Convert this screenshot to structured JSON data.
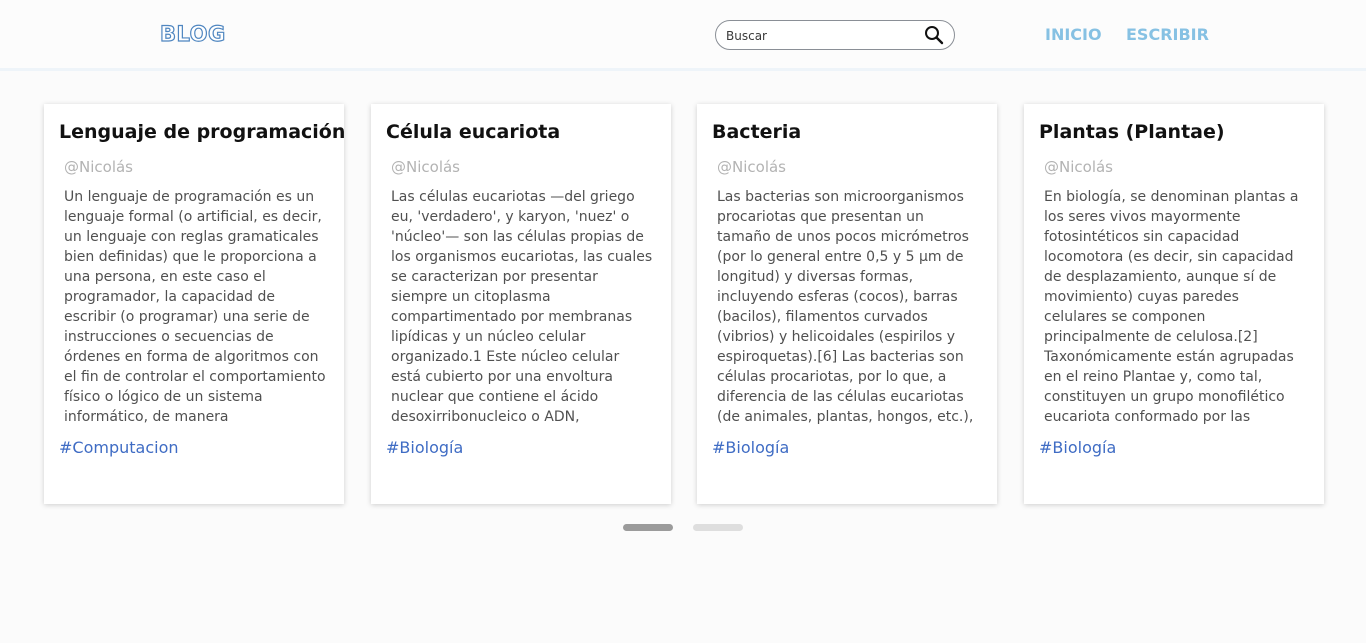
{
  "header": {
    "logo": "BLOG",
    "search": {
      "placeholder": "Buscar",
      "value": ""
    },
    "nav": [
      {
        "label": "INICIO"
      },
      {
        "label": "ESCRIBIR"
      }
    ]
  },
  "cards": [
    {
      "title": "Lenguaje de programación",
      "author": "@Nicolás",
      "body": "Un lenguaje de programación es un lenguaje formal (o artificial, es decir, un lenguaje con reglas gramaticales bien definidas) que le proporciona a una persona, en este caso el programador, la capacidad de escribir (o programar) una serie de instrucciones o secuencias de órdenes en forma de algoritmos con el fin de controlar el comportamiento físico o lógico de un sistema informático, de manera",
      "tag": "#Computacion"
    },
    {
      "title": "Célula eucariota",
      "author": "@Nicolás",
      "body": "Las células eucariotas —del griego eu, 'verdadero', y karyon, 'nuez' o 'núcleo'— son las células propias de los organismos eucariotas, las cuales se caracterizan por presentar siempre un citoplasma compartimentado por membranas lipídicas y un núcleo celular organizado.1 Este núcleo celular está cubierto por una envoltura nuclear que contiene el ácido desoxirribonucleico o ADN,",
      "tag": "#Biología"
    },
    {
      "title": "Bacteria",
      "author": "@Nicolás",
      "body": "Las bacterias son microorganismos procariotas que presentan un tamaño de unos pocos micrómetros (por lo general entre 0,5 y 5 μm de longitud) y diversas formas, incluyendo esferas (cocos), barras (bacilos), filamentos curvados (vibrios) y helicoidales (espirilos y espiroquetas).[6] Las bacterias son células procariotas, por lo que, a diferencia de las células eucariotas (de animales, plantas, hongos, etc.),",
      "tag": "#Biología"
    },
    {
      "title": "Plantas (Plantae)",
      "author": "@Nicolás",
      "body": "En biología, se denominan plantas a los seres vivos mayormente fotosintéticos sin capacidad locomotora (es decir, sin capacidad de desplazamiento, aunque sí de movimiento) cuyas paredes celulares se componen principalmente de celulosa.[2] Taxonómicamente están agrupadas en el reino Plantae y, como tal, constituyen un grupo monofilético eucariota conformado por las",
      "tag": "#Biología"
    }
  ],
  "pagination": {
    "pages": 2,
    "active_page": 1
  },
  "colors": {
    "logo_outline": "#4f86c0",
    "nav": "#86c1e3",
    "tag": "#3f6cc4",
    "dot_active": "#9b9b9b",
    "dot_inactive": "#dedede"
  },
  "icons": {
    "search": "search-icon"
  }
}
